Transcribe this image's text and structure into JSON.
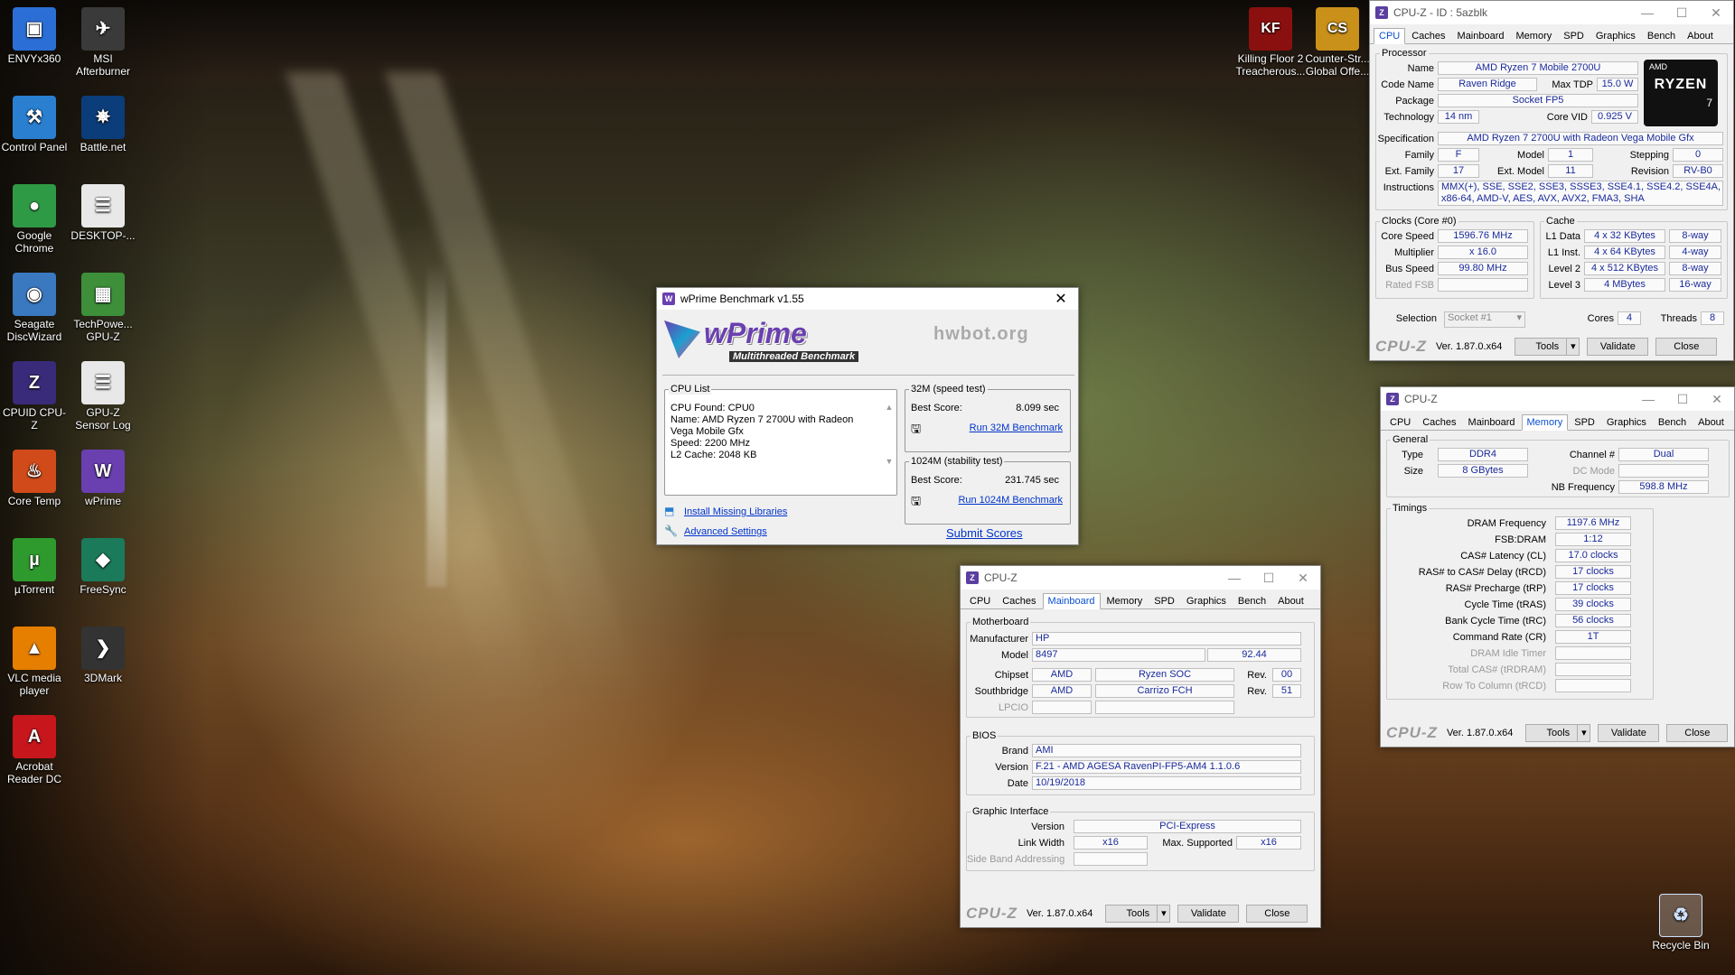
{
  "desktop": {
    "icons": [
      {
        "label": "ENVYx360",
        "glyph": "▣",
        "color": "#2b6fd6"
      },
      {
        "label": "MSI Afterburner",
        "glyph": "✈",
        "color": "#3a3a3a"
      },
      {
        "label": "Control Panel",
        "glyph": "⚒",
        "color": "#2a7fd0"
      },
      {
        "label": "Battle.net",
        "glyph": "✵",
        "color": "#0b3d7a"
      },
      {
        "label": "Google Chrome",
        "glyph": "●",
        "color": "#2f9a45"
      },
      {
        "label": "DESKTOP-...",
        "glyph": "☰",
        "color": "#e8e8e8"
      },
      {
        "label": "Seagate DiscWizard",
        "glyph": "◉",
        "color": "#3a78c0"
      },
      {
        "label": "TechPowe... GPU-Z",
        "glyph": "▦",
        "color": "#3d8f3a"
      },
      {
        "label": "CPUID CPU-Z",
        "glyph": "Z",
        "color": "#3a2b7a"
      },
      {
        "label": "GPU-Z Sensor Log",
        "glyph": "☰",
        "color": "#e8e8e8"
      },
      {
        "label": "Core Temp",
        "glyph": "♨",
        "color": "#d04a1a"
      },
      {
        "label": "wPrime",
        "glyph": "W",
        "color": "#6a3fb0"
      },
      {
        "label": "µTorrent",
        "glyph": "µ",
        "color": "#2e9a2e"
      },
      {
        "label": "FreeSync",
        "glyph": "◆",
        "color": "#1b7a5a"
      },
      {
        "label": "VLC media player",
        "glyph": "▲",
        "color": "#e67e00"
      },
      {
        "label": "3DMark",
        "glyph": "❯",
        "color": "#333"
      },
      {
        "label": "Acrobat Reader DC",
        "glyph": "A",
        "color": "#c8161d"
      }
    ],
    "top_icons": [
      {
        "label": "Killing Floor 2 Treacherous...",
        "glyph": "KF",
        "color": "#8a1010"
      },
      {
        "label": "Counter-Str... Global Offe...",
        "glyph": "CS",
        "color": "#c9901a"
      }
    ],
    "recycle_bin": "Recycle Bin"
  },
  "wprime": {
    "title": "wPrime Benchmark v1.55",
    "logo": "wPrime",
    "logo_sub": "Multithreaded Benchmark",
    "hwbot": "hwbot.org",
    "cpu_list_label": "CPU List",
    "cpu_lines": [
      "CPU Found: CPU0",
      "Name:   AMD Ryzen 7 2700U with Radeon",
      "Vega Mobile Gfx",
      "Speed:   2200 MHz",
      "L2 Cache: 2048 KB"
    ],
    "speed_label": "32M (speed test)",
    "best_score_label": "Best Score:",
    "best32": "8.099 sec",
    "run32": "Run 32M Benchmark",
    "stab_label": "1024M (stability test)",
    "best1024": "231.745 sec",
    "run1024": "Run 1024M Benchmark",
    "install": "Install Missing Libraries",
    "advanced": "Advanced Settings",
    "submit": "Submit Scores"
  },
  "cpuz_cpu": {
    "title": "CPU-Z  - ID : 5azblk",
    "tabs": [
      "CPU",
      "Caches",
      "Mainboard",
      "Memory",
      "SPD",
      "Graphics",
      "Bench",
      "About"
    ],
    "processor": "Processor",
    "name_l": "Name",
    "name": "AMD Ryzen 7 Mobile 2700U",
    "codename_l": "Code Name",
    "codename": "Raven Ridge",
    "maxtdp_l": "Max TDP",
    "maxtdp": "15.0 W",
    "package_l": "Package",
    "package": "Socket FP5",
    "tech_l": "Technology",
    "tech": "14 nm",
    "corevid_l": "Core VID",
    "corevid": "0.925 V",
    "spec_l": "Specification",
    "spec": "AMD Ryzen 7 2700U with Radeon Vega Mobile Gfx",
    "family_l": "Family",
    "family": "F",
    "model_l": "Model",
    "model": "1",
    "stepping_l": "Stepping",
    "stepping": "0",
    "extfam_l": "Ext. Family",
    "extfam": "17",
    "extmod_l": "Ext. Model",
    "extmod": "11",
    "rev_l": "Revision",
    "rev": "RV-B0",
    "instr_l": "Instructions",
    "instr1": "MMX(+), SSE, SSE2, SSE3, SSSE3, SSE4.1, SSE4.2, SSE4A,",
    "instr2": "x86-64, AMD-V, AES, AVX, AVX2, FMA3, SHA",
    "clocks": "Clocks (Core #0)",
    "corespeed_l": "Core Speed",
    "corespeed": "1596.76 MHz",
    "mult_l": "Multiplier",
    "mult": "x 16.0",
    "bus_l": "Bus Speed",
    "bus": "99.80 MHz",
    "fsb_l": "Rated FSB",
    "cache": "Cache",
    "l1d_l": "L1 Data",
    "l1d": "4 x 32 KBytes",
    "l1d_w": "8-way",
    "l1i_l": "L1 Inst.",
    "l1i": "4 x 64 KBytes",
    "l1i_w": "4-way",
    "l2_l": "Level 2",
    "l2": "4 x 512 KBytes",
    "l2_w": "8-way",
    "l3_l": "Level 3",
    "l3": "4 MBytes",
    "l3_w": "16-way",
    "sel_l": "Selection",
    "sel": "Socket #1",
    "cores_l": "Cores",
    "cores": "4",
    "threads_l": "Threads",
    "threads": "8",
    "logo": "CPU-Z",
    "ver": "Ver. 1.87.0.x64",
    "tools": "Tools",
    "validate": "Validate",
    "close": "Close",
    "badge_top": "AMD",
    "badge": "RYZEN",
    "badge_num": "7"
  },
  "cpuz_mem": {
    "title": "CPU-Z",
    "general": "General",
    "type_l": "Type",
    "type": "DDR4",
    "size_l": "Size",
    "size": "8 GBytes",
    "chan_l": "Channel #",
    "chan": "Dual",
    "dc_l": "DC Mode",
    "nb_l": "NB Frequency",
    "nb": "598.8 MHz",
    "timings": "Timings",
    "rows": [
      {
        "l": "DRAM Frequency",
        "v": "1197.6 MHz",
        "d": false
      },
      {
        "l": "FSB:DRAM",
        "v": "1:12",
        "d": false
      },
      {
        "l": "CAS# Latency (CL)",
        "v": "17.0 clocks",
        "d": false
      },
      {
        "l": "RAS# to CAS# Delay (tRCD)",
        "v": "17 clocks",
        "d": false
      },
      {
        "l": "RAS# Precharge (tRP)",
        "v": "17 clocks",
        "d": false
      },
      {
        "l": "Cycle Time (tRAS)",
        "v": "39 clocks",
        "d": false
      },
      {
        "l": "Bank Cycle Time (tRC)",
        "v": "56 clocks",
        "d": false
      },
      {
        "l": "Command Rate (CR)",
        "v": "1T",
        "d": false
      },
      {
        "l": "DRAM Idle Timer",
        "v": "",
        "d": true
      },
      {
        "l": "Total CAS# (tRDRAM)",
        "v": "",
        "d": true
      },
      {
        "l": "Row To Column (tRCD)",
        "v": "",
        "d": true
      }
    ]
  },
  "cpuz_mb": {
    "title": "CPU-Z",
    "motherboard": "Motherboard",
    "manu_l": "Manufacturer",
    "manu": "HP",
    "model_l": "Model",
    "model": "8497",
    "model2": "92.44",
    "chipset_l": "Chipset",
    "chipset_v": "AMD",
    "chipset_n": "Ryzen SOC",
    "rev_l": "Rev.",
    "chipset_rev": "00",
    "south_l": "Southbridge",
    "south_v": "AMD",
    "south_n": "Carrizo FCH",
    "south_rev": "51",
    "lpcio_l": "LPCIO",
    "bios": "BIOS",
    "brand_l": "Brand",
    "brand": "AMI",
    "version_l": "Version",
    "version": "F.21 - AMD AGESA RavenPI-FP5-AM4 1.1.0.6",
    "date_l": "Date",
    "date": "10/19/2018",
    "gi": "Graphic Interface",
    "giver_l": "Version",
    "giver": "PCI-Express",
    "lw_l": "Link Width",
    "lw": "x16",
    "maxs_l": "Max. Supported",
    "maxs": "x16",
    "sba_l": "Side Band Addressing"
  }
}
